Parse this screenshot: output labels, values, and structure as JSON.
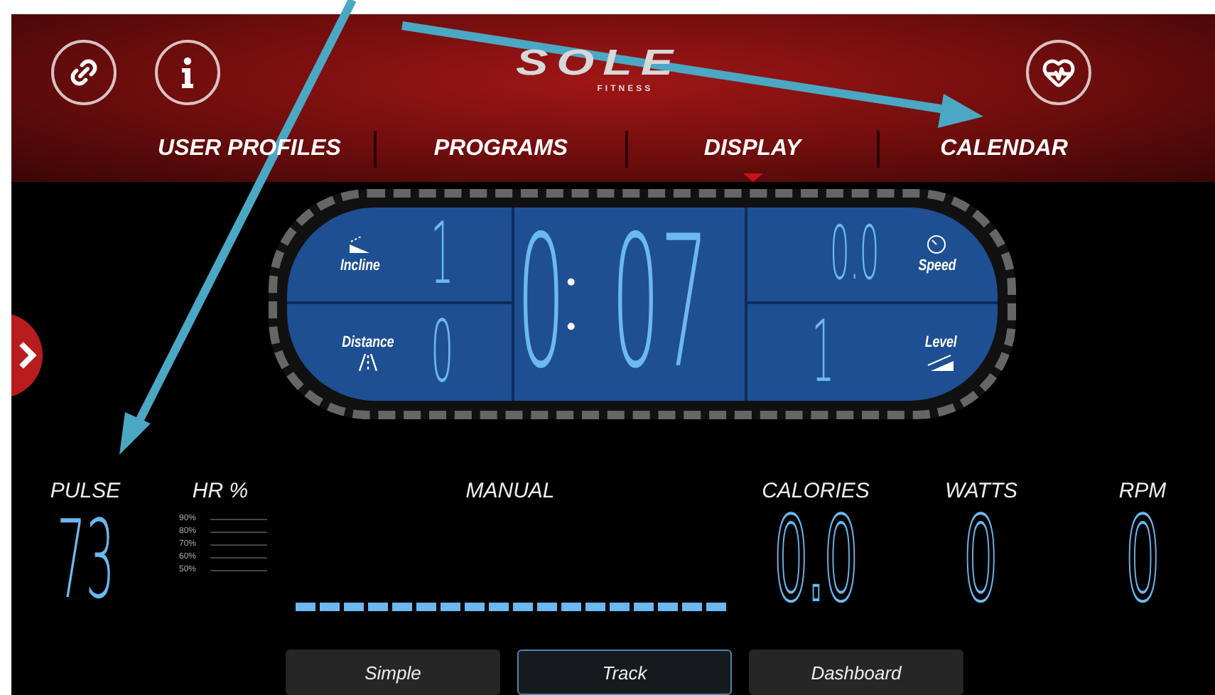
{
  "header": {
    "logo": "SOLE",
    "logo_sub": "FITNESS"
  },
  "nav": [
    {
      "label": "USER PROFILES",
      "selected": false
    },
    {
      "label": "PROGRAMS",
      "selected": false
    },
    {
      "label": "DISPLAY",
      "selected": true
    },
    {
      "label": "CALENDAR",
      "selected": false
    }
  ],
  "console": {
    "incline": {
      "label": "Incline",
      "value": "1"
    },
    "distance": {
      "label": "Distance",
      "value": "0"
    },
    "time": {
      "minutes": "0",
      "seconds": "07"
    },
    "speed": {
      "label": "Speed",
      "value": "0.0"
    },
    "level": {
      "label": "Level",
      "value": "1"
    }
  },
  "stats": {
    "pulse": {
      "label": "PULSE",
      "value": "73"
    },
    "hr": {
      "label": "HR %",
      "scale": [
        "90%",
        "80%",
        "70%",
        "60%",
        "50%"
      ]
    },
    "program": {
      "label": "MANUAL"
    },
    "calories": {
      "label": "CALORIES",
      "value": "0.0"
    },
    "watts": {
      "label": "WATTS",
      "value": "0"
    },
    "rpm": {
      "label": "RPM",
      "value": "0"
    }
  },
  "views": [
    {
      "label": "Simple",
      "selected": false
    },
    {
      "label": "Track",
      "selected": true
    },
    {
      "label": "Dashboard",
      "selected": false
    }
  ]
}
